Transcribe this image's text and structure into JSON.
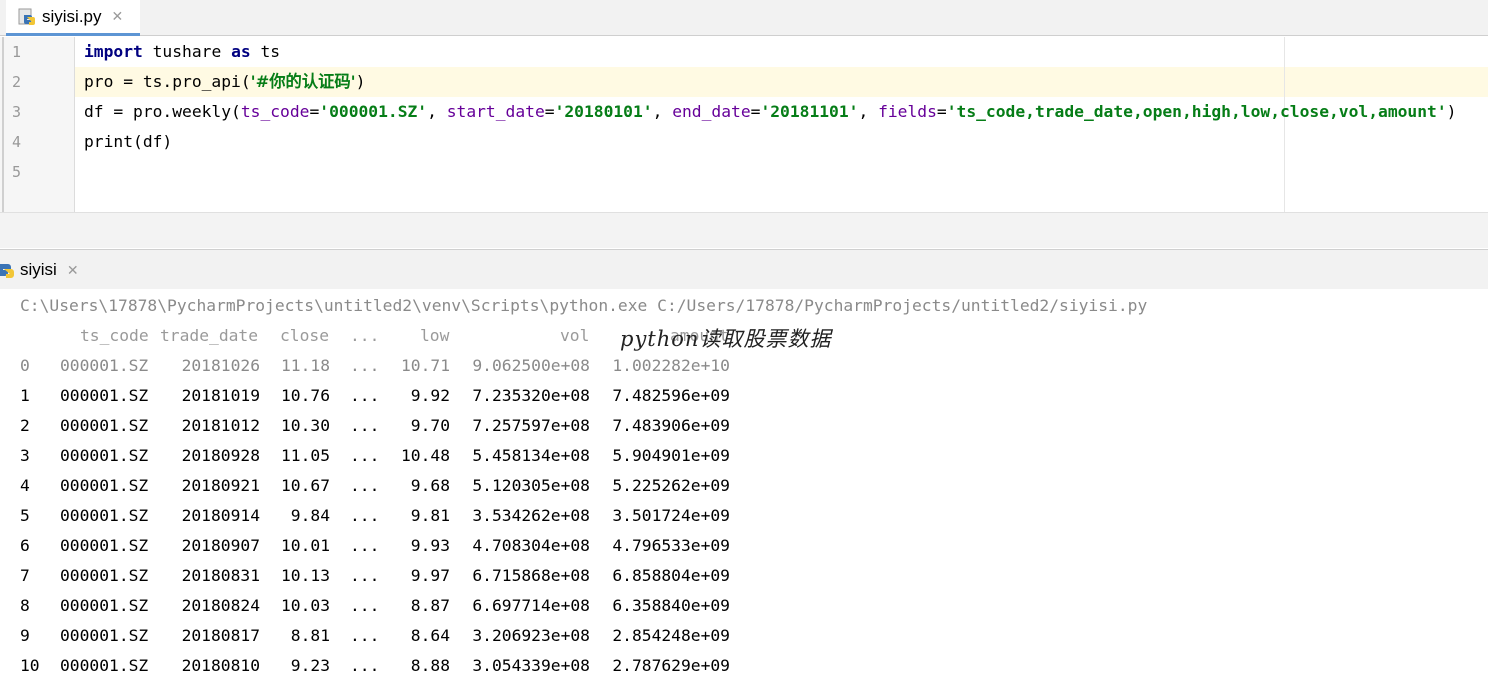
{
  "editor_tab": {
    "label": "siyisi.py",
    "close": "✕"
  },
  "editor": {
    "line_numbers": [
      "1",
      "2",
      "3",
      "4",
      "5"
    ],
    "line1": {
      "kw1": "import",
      "t1": " tushare ",
      "kw2": "as",
      "t2": " ts"
    },
    "line2": {
      "t1": "pro = ts.pro_api(",
      "s1": "'#你的认证码'",
      "t2": ")"
    },
    "line3": {
      "t1": "df = pro.weekly(",
      "p1": "ts_code",
      "e1": "=",
      "s1": "'000001.SZ'",
      "c1": ", ",
      "p2": "start_date",
      "e2": "=",
      "s2": "'20180101'",
      "c2": ", ",
      "p3": "end_date",
      "e3": "=",
      "s3": "'20181101'",
      "c3": ", ",
      "p4": "fields",
      "e4": "=",
      "s4": "'ts_code,trade_date,open,high,low,close,vol,amount'",
      "t2": ")"
    },
    "line4": {
      "t1": "print(df)"
    }
  },
  "run_tab": {
    "label": "siyisi",
    "close": "✕"
  },
  "console": {
    "command": "C:\\Users\\17878\\PycharmProjects\\untitled2\\venv\\Scripts\\python.exe C:/Users/17878/PycharmProjects/untitled2/siyisi.py",
    "annotation": "python读取股票数据",
    "headers": [
      "ts_code",
      "trade_date",
      "close",
      "...",
      "low",
      "vol",
      "amount"
    ],
    "rows": [
      [
        "0",
        "000001.SZ",
        "20181026",
        "11.18",
        "...",
        "10.71",
        "9.062500e+08",
        "1.002282e+10"
      ],
      [
        "1",
        "000001.SZ",
        "20181019",
        "10.76",
        "...",
        "9.92",
        "7.235320e+08",
        "7.482596e+09"
      ],
      [
        "2",
        "000001.SZ",
        "20181012",
        "10.30",
        "...",
        "9.70",
        "7.257597e+08",
        "7.483906e+09"
      ],
      [
        "3",
        "000001.SZ",
        "20180928",
        "11.05",
        "...",
        "10.48",
        "5.458134e+08",
        "5.904901e+09"
      ],
      [
        "4",
        "000001.SZ",
        "20180921",
        "10.67",
        "...",
        "9.68",
        "5.120305e+08",
        "5.225262e+09"
      ],
      [
        "5",
        "000001.SZ",
        "20180914",
        "9.84",
        "...",
        "9.81",
        "3.534262e+08",
        "3.501724e+09"
      ],
      [
        "6",
        "000001.SZ",
        "20180907",
        "10.01",
        "...",
        "9.93",
        "4.708304e+08",
        "4.796533e+09"
      ],
      [
        "7",
        "000001.SZ",
        "20180831",
        "10.13",
        "...",
        "9.97",
        "6.715868e+08",
        "6.858804e+09"
      ],
      [
        "8",
        "000001.SZ",
        "20180824",
        "10.03",
        "...",
        "8.87",
        "6.697714e+08",
        "6.358840e+09"
      ],
      [
        "9",
        "000001.SZ",
        "20180817",
        "8.81",
        "...",
        "8.64",
        "3.206923e+08",
        "2.854248e+09"
      ],
      [
        "10",
        "000001.SZ",
        "20180810",
        "9.23",
        "...",
        "8.88",
        "3.054339e+08",
        "2.787629e+09"
      ]
    ]
  }
}
